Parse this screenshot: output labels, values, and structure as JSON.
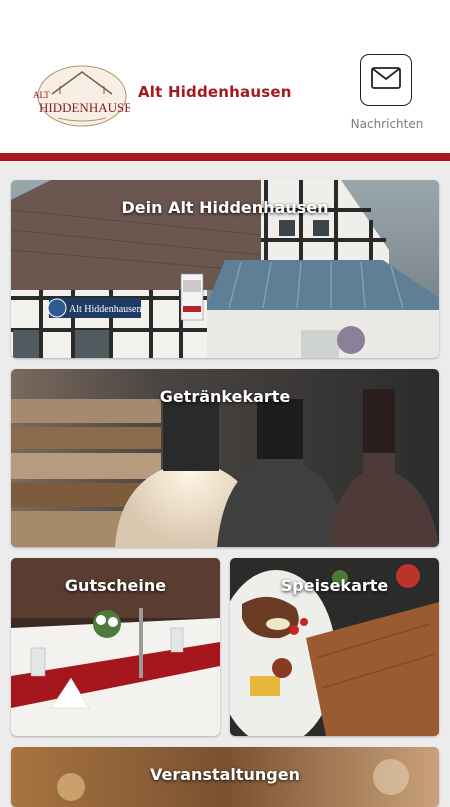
{
  "header": {
    "logo_text_top": "ALT",
    "logo_text_main": "HIDDENHAUSEN",
    "title": "Alt Hiddenhausen",
    "messages_label": "Nachrichten",
    "messages_icon": "envelope-icon"
  },
  "tiles": [
    {
      "label": "Dein Alt Hiddenhausen"
    },
    {
      "label": "Getränkekarte"
    },
    {
      "label": "Gutscheine"
    },
    {
      "label": "Speisekarte"
    },
    {
      "label": "Veranstaltungen"
    }
  ],
  "sign_text": "Alt Hiddenhausen",
  "colors": {
    "accent": "#a51a1f",
    "background": "#ececec"
  }
}
